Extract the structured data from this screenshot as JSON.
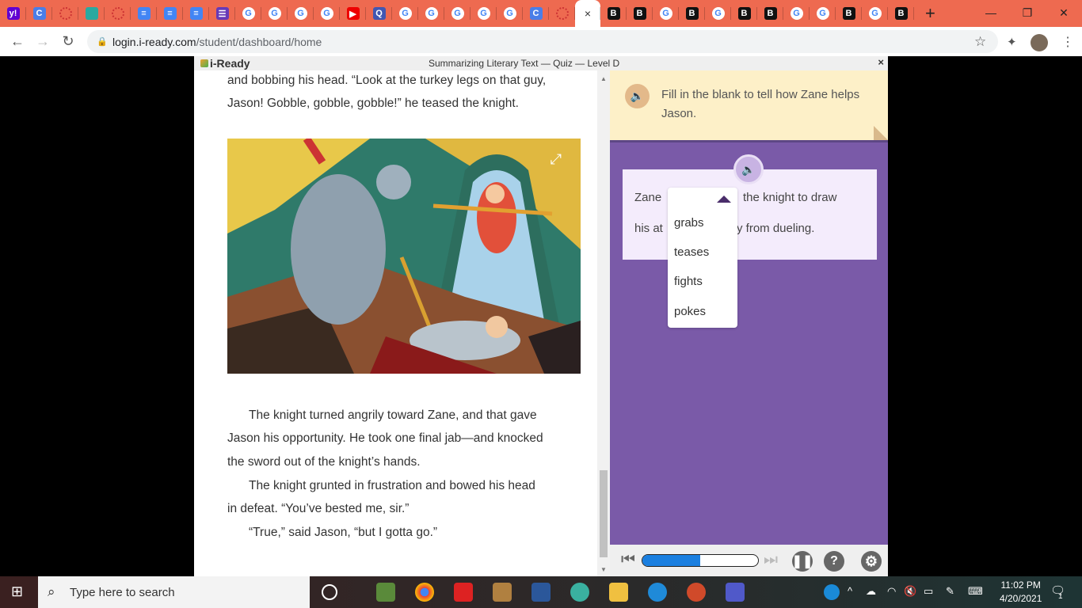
{
  "browser": {
    "tabs": [
      {
        "icon": "yahoo",
        "bg": "#6001d2",
        "t": "y!"
      },
      {
        "icon": "c",
        "bg": "#4a7ee8",
        "t": "C"
      },
      {
        "icon": "loading",
        "bg": "none",
        "t": ""
      },
      {
        "icon": "meet",
        "bg": "#2aa9a0",
        "t": ""
      },
      {
        "icon": "loading",
        "bg": "none",
        "t": ""
      },
      {
        "icon": "docs",
        "bg": "#4285f4",
        "t": "≡"
      },
      {
        "icon": "docs",
        "bg": "#4285f4",
        "t": "≡"
      },
      {
        "icon": "docs",
        "bg": "#4285f4",
        "t": "≡"
      },
      {
        "icon": "forms",
        "bg": "#673ab7",
        "t": "☰"
      },
      {
        "icon": "google",
        "bg": "#fff",
        "t": "G"
      },
      {
        "icon": "google",
        "bg": "#fff",
        "t": "G"
      },
      {
        "icon": "google",
        "bg": "#fff",
        "t": "G"
      },
      {
        "icon": "google",
        "bg": "#fff",
        "t": "G"
      },
      {
        "icon": "youtube",
        "bg": "#e00",
        "t": "▶"
      },
      {
        "icon": "quizlet",
        "bg": "#4257b2",
        "t": "Q"
      },
      {
        "icon": "google",
        "bg": "#fff",
        "t": "G"
      },
      {
        "icon": "google",
        "bg": "#fff",
        "t": "G"
      },
      {
        "icon": "google",
        "bg": "#fff",
        "t": "G"
      },
      {
        "icon": "google",
        "bg": "#fff",
        "t": "G"
      },
      {
        "icon": "google",
        "bg": "#fff",
        "t": "G"
      },
      {
        "icon": "c",
        "bg": "#4a7ee8",
        "t": "C"
      },
      {
        "icon": "loading",
        "bg": "none",
        "t": ""
      },
      {
        "icon": "active",
        "bg": "",
        "t": "×"
      },
      {
        "icon": "b",
        "bg": "#111",
        "t": "B"
      },
      {
        "icon": "b",
        "bg": "#111",
        "t": "B"
      },
      {
        "icon": "google",
        "bg": "#fff",
        "t": "G"
      },
      {
        "icon": "b",
        "bg": "#111",
        "t": "B"
      },
      {
        "icon": "google",
        "bg": "#fff",
        "t": "G"
      },
      {
        "icon": "b",
        "bg": "#111",
        "t": "B"
      },
      {
        "icon": "b",
        "bg": "#111",
        "t": "B"
      },
      {
        "icon": "google",
        "bg": "#fff",
        "t": "G"
      },
      {
        "icon": "google",
        "bg": "#fff",
        "t": "G"
      },
      {
        "icon": "b",
        "bg": "#111",
        "t": "B"
      },
      {
        "icon": "google",
        "bg": "#fff",
        "t": "G"
      },
      {
        "icon": "b",
        "bg": "#111",
        "t": "B"
      }
    ],
    "new_tab": "+",
    "url_host": "login.i-ready.com",
    "url_path": "/student/dashboard/home"
  },
  "app": {
    "logo": "i-Ready",
    "title": "Summarizing Literary Text — Quiz — Level D",
    "close": "×"
  },
  "reading": {
    "p1a": "and bobbing his head. “Look at the turkey legs on that guy,",
    "p1b": "Jason! Gobble, gobble, gobble!” he teased the knight.",
    "p2a": "The knight turned angrily toward Zane, and that gave",
    "p2b": "Jason his opportunity. He took one final jab—and knocked",
    "p2c": "the sword out of the knight’s hands.",
    "p3a": "The knight grunted in frustration and bowed his head",
    "p3b": "in defeat. “You’ve bested me, sir.”",
    "p4": "“True,” said Jason, “but I gotta go.”"
  },
  "question": {
    "prompt": "Fill in the blank to tell how Zane helps Jason.",
    "s1": "Zane",
    "s2": "the knight to draw",
    "s3": "his at",
    "s4": "y from dueling.",
    "options": [
      "grabs",
      "teases",
      "fights",
      "pokes"
    ]
  },
  "controls": {
    "progress_percent": 50,
    "help": "?"
  },
  "taskbar": {
    "search_placeholder": "Type here to search",
    "time": "11:02 PM",
    "date": "4/20/2021",
    "notifications": "1"
  }
}
